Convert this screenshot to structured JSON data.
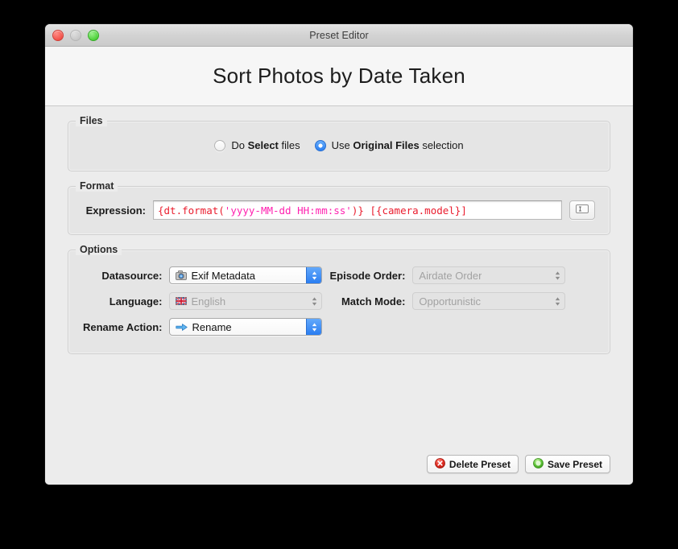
{
  "window": {
    "title": "Preset Editor",
    "traffic_lights": [
      "close-button",
      "minimize-button",
      "zoom-button"
    ]
  },
  "header": {
    "page_title": "Sort Photos by Date Taken"
  },
  "files_group": {
    "legend": "Files",
    "options": [
      {
        "prefix": "Do ",
        "strong": "Select",
        "suffix": " files",
        "selected": false
      },
      {
        "prefix": "Use ",
        "strong": "Original Files",
        "suffix": " selection",
        "selected": true
      }
    ]
  },
  "format_group": {
    "legend": "Format",
    "expression_label": "Expression:",
    "expression_value": "{dt.format('yyyy-MM-dd HH:mm:ss')} [{camera.model}]",
    "expression_tokens": [
      {
        "text": "{dt.format(",
        "kind": "brace"
      },
      {
        "text": "'yyyy-MM-dd HH:mm:ss'",
        "kind": "string"
      },
      {
        "text": ")}",
        "kind": "brace"
      },
      {
        "text": " ",
        "kind": "plain"
      },
      {
        "text": "[{camera.model}]",
        "kind": "brace"
      }
    ],
    "insert_button_icon": "text-field-icon",
    "colors": {
      "brace": "#ea1c2d",
      "string": "#ff21b0"
    }
  },
  "options_group": {
    "legend": "Options",
    "rows": [
      {
        "left_label": "Datasource:",
        "left_value": "Exif Metadata",
        "left_icon": "camera-icon",
        "left_enabled": true,
        "right_label": "Episode Order:",
        "right_value": "Airdate Order",
        "right_icon": null,
        "right_enabled": false
      },
      {
        "left_label": "Language:",
        "left_value": "English",
        "left_icon": "uk-flag-icon",
        "left_enabled": false,
        "right_label": "Match Mode:",
        "right_value": "Opportunistic",
        "right_icon": null,
        "right_enabled": false
      },
      {
        "left_label": "Rename Action:",
        "left_value": "Rename",
        "left_icon": "blue-arrow-icon",
        "left_enabled": true,
        "right_label": "",
        "right_value": "",
        "right_icon": null,
        "right_enabled": false
      }
    ]
  },
  "footer": {
    "delete_label": "Delete Preset",
    "delete_icon": "delete-circle-icon",
    "save_label": "Save Preset",
    "save_icon": "save-circle-icon",
    "colors": {
      "delete": "#d9281f",
      "save": "#57c034"
    }
  }
}
